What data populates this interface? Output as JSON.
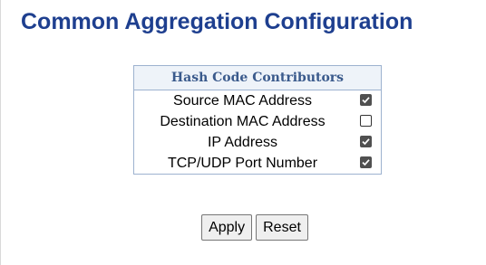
{
  "page": {
    "title": "Common Aggregation Configuration"
  },
  "table": {
    "header": "Hash Code Contributors",
    "rows": [
      {
        "label": "Source MAC Address",
        "checked": true
      },
      {
        "label": "Destination MAC Address",
        "checked": false
      },
      {
        "label": "IP Address",
        "checked": true
      },
      {
        "label": "TCP/UDP Port Number",
        "checked": true
      }
    ]
  },
  "buttons": {
    "apply_label": "Apply",
    "reset_label": "Reset"
  }
}
